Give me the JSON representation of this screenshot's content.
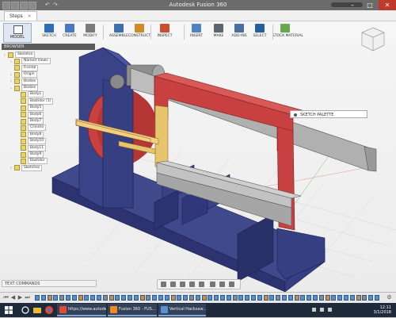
{
  "window": {
    "title": "Autodesk Fusion 360",
    "minimize_glyph": "–",
    "maximize_glyph": "□",
    "close_glyph": "✕"
  },
  "tabs": [
    {
      "label": "Steps"
    }
  ],
  "toolbar": {
    "workspace_label": "MODEL",
    "groups": [
      {
        "label": "SKETCH",
        "icon": "sketch-icon",
        "color": "#2f6db5"
      },
      {
        "label": "CREATE",
        "icon": "create-icon",
        "color": "#4a77c0"
      },
      {
        "label": "MODIFY",
        "icon": "modify-icon",
        "color": "#7a7a7a"
      },
      {
        "label": "ASSEMBLE",
        "icon": "assemble-icon",
        "color": "#3d6fa8"
      },
      {
        "label": "CONSTRUCT",
        "icon": "construct-icon",
        "color": "#d08a2a"
      },
      {
        "label": "INSPECT",
        "icon": "inspect-icon",
        "color": "#c7502e"
      },
      {
        "label": "INSERT",
        "icon": "insert-icon",
        "color": "#4f83c2"
      },
      {
        "label": "MAKE",
        "icon": "make-icon",
        "color": "#5d6670"
      },
      {
        "label": "ADD-INS",
        "icon": "add-ins-icon",
        "color": "#4a6ea0"
      },
      {
        "label": "SELECT",
        "icon": "select-icon",
        "color": "#2a5f9e"
      },
      {
        "label": "STOCK MATERIAL",
        "icon": "stock-icon",
        "color": "#6aa84f"
      }
    ]
  },
  "browser": {
    "header": "BROWSER",
    "rows": [
      {
        "label": "Skeleton",
        "depth": 0,
        "has_chevron": true
      },
      {
        "label": "Named Views",
        "depth": 1,
        "has_chevron": true
      },
      {
        "label": "Frontal",
        "depth": 1,
        "has_chevron": false
      },
      {
        "label": "Origin",
        "depth": 1,
        "has_chevron": true
      },
      {
        "label": "Bodies",
        "depth": 1,
        "has_chevron": true
      },
      {
        "label": "Bodies",
        "depth": 1,
        "has_chevron": true
      },
      {
        "label": "Body1",
        "depth": 2,
        "has_chevron": false
      },
      {
        "label": "Bastidor (1)",
        "depth": 2,
        "has_chevron": false
      },
      {
        "label": "Body5",
        "depth": 2,
        "has_chevron": false
      },
      {
        "label": "Body6",
        "depth": 2,
        "has_chevron": false
      },
      {
        "label": "Body7",
        "depth": 2,
        "has_chevron": false
      },
      {
        "label": "Cilindro",
        "depth": 2,
        "has_chevron": false
      },
      {
        "label": "Body8",
        "depth": 2,
        "has_chevron": false
      },
      {
        "label": "Body10",
        "depth": 2,
        "has_chevron": false
      },
      {
        "label": "Body11",
        "depth": 2,
        "has_chevron": false
      },
      {
        "label": "Body9",
        "depth": 2,
        "has_chevron": false
      },
      {
        "label": "Bastidor",
        "depth": 2,
        "has_chevron": false
      },
      {
        "label": "Sketches",
        "depth": 1,
        "has_chevron": true
      }
    ]
  },
  "sketch_palette": "SKETCH PALETTE",
  "text_commands": "TEXT COMMANDS",
  "colors": {
    "frame_blue": "#363f82",
    "arm_red": "#c8403f",
    "rail_gray": "#aaaaaa",
    "slider_yellow": "#e7c56e",
    "taskbar": "#1f2a3a",
    "accent": "#2f6db5"
  },
  "taskbar": {
    "apps": [
      {
        "label": "https://www.autodesk.c...",
        "icon": "chrome-icon",
        "color": "#e04b32"
      },
      {
        "label": "Fusion 360 - FUS...",
        "icon": "fusion-icon",
        "color": "#f08a1e"
      },
      {
        "label": "Vertical Hacksaw...",
        "icon": "fusion-file-icon",
        "color": "#5b8fd3"
      }
    ],
    "time": "12:11",
    "date": "3/1/2018"
  }
}
